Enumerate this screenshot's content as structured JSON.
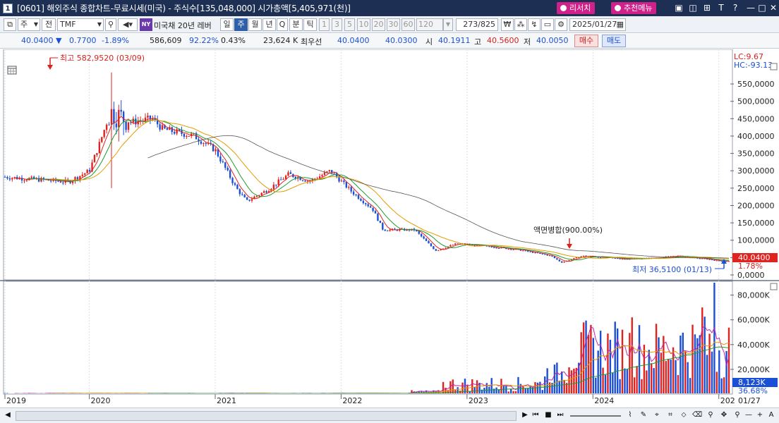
{
  "window": {
    "number": "1",
    "title": "[0601] 해외주식 종합차트-무료시세(미국) - 주식수[135,048,000] 시가총액[5,405,971(천)]",
    "report_button": "리서치",
    "menu_button": "추천메뉴"
  },
  "toolbar": {
    "type_select": "주",
    "prev_label": "전",
    "symbol": "TMF",
    "ny_badge": "NY",
    "stock_name": "미국채 20년 레버",
    "periods": [
      "일",
      "주",
      "월",
      "년",
      "Q",
      "분",
      "틱"
    ],
    "active_period": "주",
    "intervals": [
      "1",
      "3",
      "5",
      "10",
      "20",
      "30",
      "60",
      "120"
    ],
    "count": "273",
    "total": "/825",
    "date": "2025/01/27"
  },
  "quote": {
    "price": "40.0400",
    "change": "0.7700",
    "change_pct": "-1.89%",
    "volume": "586,609",
    "vol_ratio": "92.22%",
    "turnover": "0.43%",
    "amount": "23,624 K",
    "best_label": "최우선",
    "ask": "40.0400",
    "bid": "40.0300",
    "open_label": "시",
    "open": "40.1911",
    "high_label": "고",
    "high": "40.5600",
    "low_label": "저",
    "low": "40.0050",
    "buy_label": "매수",
    "sell_label": "매도"
  },
  "chart": {
    "lc_label": "LC:9.67",
    "hc_label": "HC:-93.13",
    "high_annotation": "최고 582,9520 (03/09)",
    "low_annotation": "최저 36,5100 (01/13)",
    "split_annotation": "액면병합(900.00%)",
    "current_price_tag": "40.0400",
    "current_pct_tag": "1.78%",
    "volume_tag": "8,123K",
    "volume_pct_tag": "36.68%",
    "price_axis_labels": [
      "550,0000",
      "500,0000",
      "450,0000",
      "400,0000",
      "350,0000",
      "300,0000",
      "250,0000",
      "200,0000",
      "150,0000",
      "100,0000",
      "50,0000",
      "0,0000"
    ],
    "volume_axis_labels": [
      "80,000K",
      "60,000K",
      "40,000K",
      "20,000K"
    ],
    "time_labels": [
      "2019",
      "2020",
      "2021",
      "2022",
      "2023",
      "2024",
      "202",
      "01/27"
    ]
  },
  "chart_data": {
    "type": "candlestick",
    "symbol": "TMF",
    "interval": "weekly",
    "price_ylim": [
      0,
      600
    ],
    "volume_ylim_k": [
      0,
      90000
    ],
    "price_path": [
      [
        "2019-05",
        282
      ],
      [
        "2019-08",
        275
      ],
      [
        "2019-11",
        268
      ],
      [
        "2020-01",
        300
      ],
      [
        "2020-02",
        380
      ],
      [
        "2020-03",
        470
      ],
      [
        "2020-05",
        440
      ],
      [
        "2020-07",
        450
      ],
      [
        "2020-08",
        420
      ],
      [
        "2020-11",
        400
      ],
      [
        "2021-01",
        360
      ],
      [
        "2021-03",
        250
      ],
      [
        "2021-04",
        212
      ],
      [
        "2021-06",
        245
      ],
      [
        "2021-08",
        290
      ],
      [
        "2021-10",
        270
      ],
      [
        "2021-12",
        300
      ],
      [
        "2022-02",
        240
      ],
      [
        "2022-04",
        190
      ],
      [
        "2022-05",
        130
      ],
      [
        "2022-08",
        130
      ],
      [
        "2022-10",
        70
      ],
      [
        "2022-12",
        90
      ],
      [
        "2023-03",
        82
      ],
      [
        "2023-06",
        72
      ],
      [
        "2023-09",
        55
      ],
      [
        "2023-10",
        36
      ],
      [
        "2023-12",
        55
      ],
      [
        "2024-04",
        46
      ],
      [
        "2024-07",
        49
      ],
      [
        "2024-09",
        55
      ],
      [
        "2024-12",
        45
      ],
      [
        "2025-01",
        40
      ]
    ],
    "high": {
      "value": 582.952,
      "date": "03/09"
    },
    "low": {
      "value": 36.51,
      "date": "01/13"
    },
    "last_close": 40.04
  }
}
